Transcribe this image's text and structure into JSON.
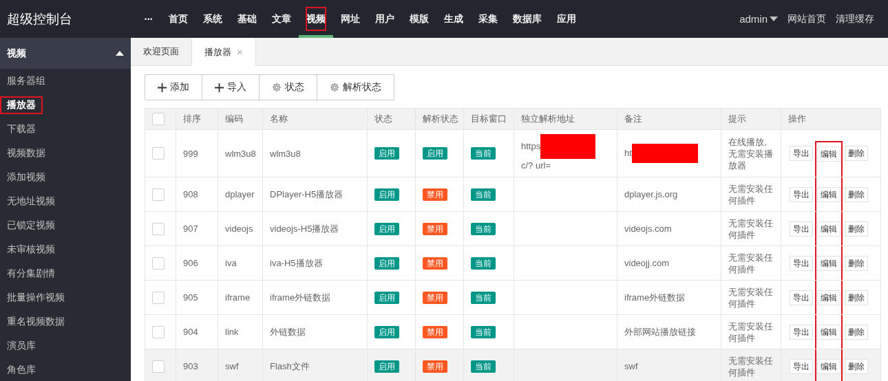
{
  "brand": "超级控制台",
  "nav": {
    "more": "•••",
    "items": [
      {
        "label": "首页",
        "selected": false,
        "marked": false
      },
      {
        "label": "系统",
        "selected": false,
        "marked": false
      },
      {
        "label": "基础",
        "selected": false,
        "marked": false
      },
      {
        "label": "文章",
        "selected": false,
        "marked": false
      },
      {
        "label": "视频",
        "selected": true,
        "marked": true
      },
      {
        "label": "网址",
        "selected": false,
        "marked": false
      },
      {
        "label": "用户",
        "selected": false,
        "marked": false
      },
      {
        "label": "模版",
        "selected": false,
        "marked": false
      },
      {
        "label": "生成",
        "selected": false,
        "marked": false
      },
      {
        "label": "采集",
        "selected": false,
        "marked": false
      },
      {
        "label": "数据库",
        "selected": false,
        "marked": false
      },
      {
        "label": "应用",
        "selected": false,
        "marked": false
      }
    ]
  },
  "user_menu": {
    "user": "admin",
    "links": [
      "网站首页",
      "清理缓存"
    ]
  },
  "sidebar": {
    "group": {
      "label": "视频",
      "expanded": true
    },
    "items": [
      {
        "label": "服务器组",
        "selected": false,
        "marked": false
      },
      {
        "label": "播放器",
        "selected": true,
        "marked": true
      },
      {
        "label": "下载器",
        "selected": false,
        "marked": false
      },
      {
        "label": "视频数据",
        "selected": false,
        "marked": false
      },
      {
        "label": "添加视频",
        "selected": false,
        "marked": false
      },
      {
        "label": "无地址视频",
        "selected": false,
        "marked": false
      },
      {
        "label": "已锁定视频",
        "selected": false,
        "marked": false
      },
      {
        "label": "未审核视频",
        "selected": false,
        "marked": false
      },
      {
        "label": "有分集剧情",
        "selected": false,
        "marked": false
      },
      {
        "label": "批量操作视频",
        "selected": false,
        "marked": false
      },
      {
        "label": "重名视频数据",
        "selected": false,
        "marked": false
      },
      {
        "label": "演员库",
        "selected": false,
        "marked": false
      },
      {
        "label": "角色库",
        "selected": false,
        "marked": false
      }
    ]
  },
  "tabs": [
    {
      "label": "欢迎页面",
      "selected": false,
      "closable": false
    },
    {
      "label": "播放器",
      "selected": true,
      "closable": true,
      "close": "×"
    }
  ],
  "toolbar": [
    {
      "label": "添加"
    },
    {
      "label": "导入"
    },
    {
      "label": "状态"
    },
    {
      "label": "解析状态"
    }
  ],
  "table": {
    "all_checked": false,
    "edit_marked": true,
    "columns": [
      "排序",
      "编码",
      "名称",
      "状态",
      "解析状态",
      "目标窗口",
      "独立解析地址",
      "备注",
      "提示",
      "操作"
    ],
    "rows": [
      {
        "checked": false,
        "hovered": false,
        "sort": "999",
        "code": "wlm3u8",
        "name": "wlm3u8",
        "status": {
          "text": "启用",
          "on": true
        },
        "parse_status": {
          "text": "启用",
          "on": true
        },
        "target": "当前",
        "address": [
          {
            "kind": "text",
            "text": "https"
          },
          {
            "kind": "redacted"
          },
          {
            "kind": "text",
            "text": "c/? url="
          }
        ],
        "note": [
          {
            "kind": "text",
            "text": "ht"
          },
          {
            "kind": "redacted"
          }
        ],
        "tip": "在线播放,无需安装播放器",
        "actions": [
          "导出",
          "编辑",
          "删除"
        ]
      },
      {
        "checked": false,
        "hovered": false,
        "sort": "908",
        "code": "dplayer",
        "name": "DPlayer-H5播放器",
        "status": {
          "text": "启用",
          "on": true
        },
        "parse_status": {
          "text": "禁用",
          "on": false
        },
        "target": "当前",
        "address": [],
        "note": [
          {
            "kind": "text",
            "text": "dplayer.js.org"
          }
        ],
        "tip": "无需安装任何插件",
        "actions": [
          "导出",
          "编辑",
          "删除"
        ]
      },
      {
        "checked": false,
        "hovered": false,
        "sort": "907",
        "code": "videojs",
        "name": "videojs-H5播放器",
        "status": {
          "text": "启用",
          "on": true
        },
        "parse_status": {
          "text": "禁用",
          "on": false
        },
        "target": "当前",
        "address": [],
        "note": [
          {
            "kind": "text",
            "text": "videojs.com"
          }
        ],
        "tip": "无需安装任何插件",
        "actions": [
          "导出",
          "编辑",
          "删除"
        ]
      },
      {
        "checked": false,
        "hovered": false,
        "sort": "906",
        "code": "iva",
        "name": "iva-H5播放器",
        "status": {
          "text": "启用",
          "on": true
        },
        "parse_status": {
          "text": "禁用",
          "on": false
        },
        "target": "当前",
        "address": [],
        "note": [
          {
            "kind": "text",
            "text": "videojj.com"
          }
        ],
        "tip": "无需安装任何插件",
        "actions": [
          "导出",
          "编辑",
          "删除"
        ]
      },
      {
        "checked": false,
        "hovered": false,
        "sort": "905",
        "code": "iframe",
        "name": "iframe外链数据",
        "status": {
          "text": "启用",
          "on": true
        },
        "parse_status": {
          "text": "禁用",
          "on": false
        },
        "target": "当前",
        "address": [],
        "note": [
          {
            "kind": "text",
            "text": "iframe外链数据"
          }
        ],
        "tip": "无需安装任何插件",
        "actions": [
          "导出",
          "编辑",
          "删除"
        ]
      },
      {
        "checked": false,
        "hovered": false,
        "sort": "904",
        "code": "link",
        "name": "外链数据",
        "status": {
          "text": "启用",
          "on": true
        },
        "parse_status": {
          "text": "禁用",
          "on": false
        },
        "target": "当前",
        "address": [],
        "note": [
          {
            "kind": "text",
            "text": "外部网站播放链接"
          }
        ],
        "tip": "无需安装任何插件",
        "actions": [
          "导出",
          "编辑",
          "删除"
        ]
      },
      {
        "checked": false,
        "hovered": true,
        "sort": "903",
        "code": "swf",
        "name": "Flash文件",
        "status": {
          "text": "启用",
          "on": true
        },
        "parse_status": {
          "text": "禁用",
          "on": false
        },
        "target": "当前",
        "address": [],
        "note": [
          {
            "kind": "text",
            "text": "swf"
          }
        ],
        "tip": "无需安装任何插件",
        "actions": [
          "导出",
          "编辑",
          "删除"
        ]
      }
    ]
  }
}
